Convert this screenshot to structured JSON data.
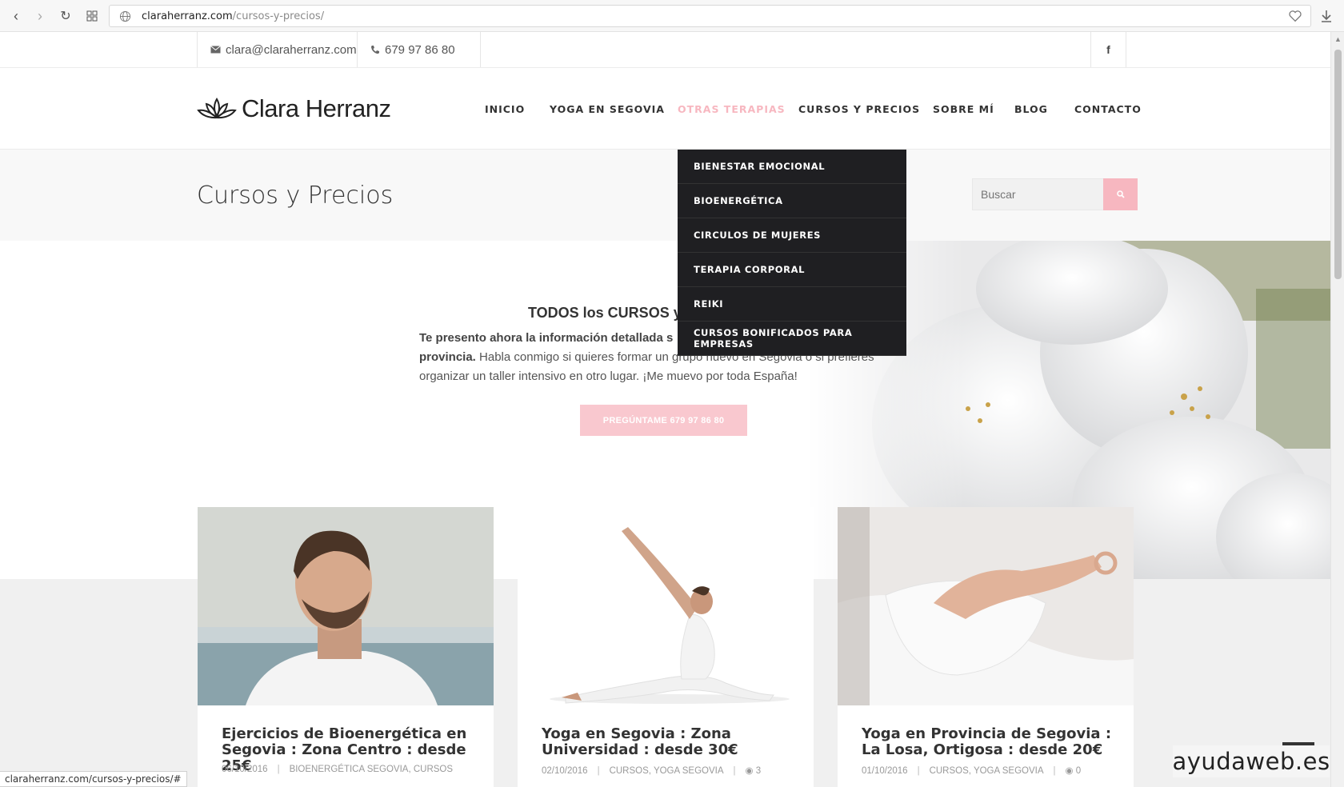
{
  "browser": {
    "url_domain": "claraherranz.com",
    "url_path": "/cursos-y-precios/",
    "status_url": "claraherranz.com/cursos-y-precios/#"
  },
  "topbar": {
    "email": "clara@claraherranz.com",
    "phone": "679 97 86 80"
  },
  "header": {
    "logo_first": "Clara",
    "logo_last": "Herranz",
    "nav": [
      {
        "label": "INICIO",
        "active": false
      },
      {
        "label": "YOGA EN SEGOVIA",
        "active": false
      },
      {
        "label": "OTRAS TERAPIAS",
        "active": true
      },
      {
        "label": "CURSOS Y PRECIOS",
        "active": false
      },
      {
        "label": "SOBRE MÍ",
        "active": false
      },
      {
        "label": "BLOG",
        "active": false
      },
      {
        "label": "CONTACTO",
        "active": false
      }
    ]
  },
  "dropdown": {
    "items": [
      "BIENESTAR EMOCIONAL",
      "BIOENERGÉTICA",
      "CIRCULOS DE MUJERES",
      "TERAPIA CORPORAL",
      "REIKI",
      "CURSOS BONIFICADOS PARA EMPRESAS"
    ]
  },
  "titleband": {
    "title": "Cursos y Precios",
    "search_placeholder": "Buscar"
  },
  "hero": {
    "heading": "TODOS los CURSOS y",
    "p_bold_1": "Te presento ahora la información detallada s",
    "p_bold_2": "provincia.",
    "p_rest": " Habla conmigo si quieres formar un grupo nuevo en Segovia o si prefieres organizar  un taller intensivo en otro lugar. ¡Me muevo por toda España!",
    "cta": "PREGÚNTAME 679 97 86 80"
  },
  "posts": [
    {
      "title": "Ejercicios de Bioenergética en Segovia : Zona Centro : desde 25€",
      "date": "06/10/2016",
      "cats": "BIOENERGÉTICA SEGOVIA, CURSOS",
      "comments": ""
    },
    {
      "title": "Yoga en Segovia : Zona Universidad : desde 30€",
      "date": "02/10/2016",
      "cats": "CURSOS, YOGA SEGOVIA",
      "comments": "3"
    },
    {
      "title": "Yoga en Provincia de Segovia : La Losa, Ortigosa : desde 20€",
      "date": "01/10/2016",
      "cats": "CURSOS, YOGA SEGOVIA",
      "comments": "0"
    }
  ],
  "colors": {
    "accent": "#f7b7c0",
    "dropdown_bg": "#1f1f22"
  },
  "watermark": "ayudaweb.es"
}
